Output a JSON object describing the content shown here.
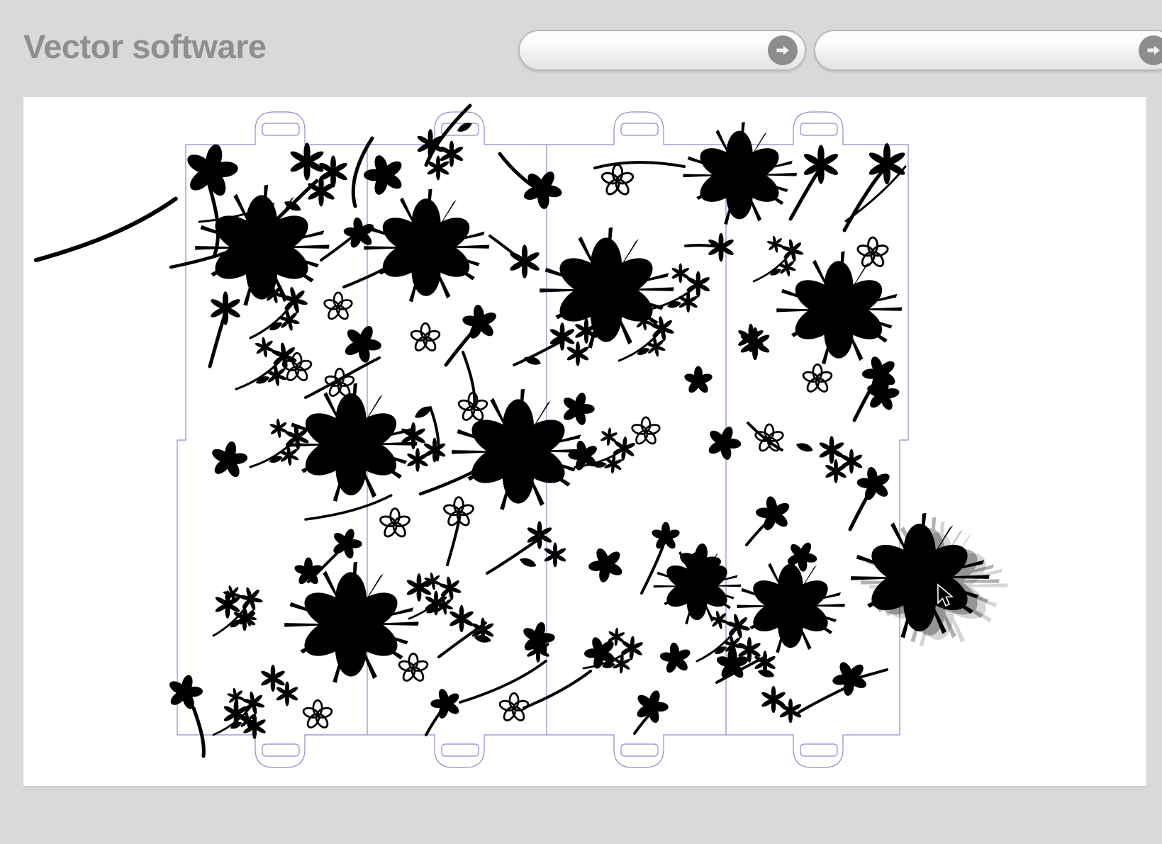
{
  "window": {
    "title": "Vector software",
    "background_color": "#d9d9d9",
    "canvas_color": "#ffffff"
  },
  "header": {
    "title": "Vector software",
    "title_color": "#8e8e8e",
    "controls": [
      {
        "name": "toolbar-pill-one",
        "type": "rounded-bar",
        "value": "",
        "placeholder": "",
        "button_icon": "arrow-right-circle-icon",
        "button_color": "#8d8d8d"
      },
      {
        "name": "toolbar-pill-two",
        "type": "rounded-bar",
        "value": "",
        "placeholder": "",
        "button_icon": "arrow-right-circle-icon",
        "button_color": "#8d8d8d"
      }
    ]
  },
  "canvas": {
    "name": "drawing-canvas",
    "artwork_title": "Floral die-cut box template",
    "dieline_color": "#8a8ad0",
    "artwork_color": "#000000",
    "template": {
      "name": "die-cut-box-template",
      "panel_count": 4,
      "top_tabs": 4,
      "bottom_tabs": 4,
      "tab_slot_shape": "rounded-rectangle"
    },
    "selection": {
      "name": "selected-flower-object",
      "state": "dragging",
      "ghost_preview": true,
      "cursor": "arrow-cursor"
    }
  }
}
